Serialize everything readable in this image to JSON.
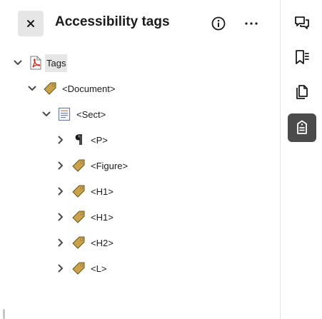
{
  "header": {
    "title": "Accessibility tags",
    "close_icon": "close-icon",
    "info_icon": "info-icon",
    "more_icon": "more-icon"
  },
  "tree": {
    "root": {
      "label": "Tags",
      "icon": "pdf-file-icon",
      "expanded": true,
      "selected": true
    },
    "document": {
      "label": "<Document>",
      "icon": "tag-icon",
      "expanded": true
    },
    "sect": {
      "label": "<Sect>",
      "icon": "section-icon",
      "expanded": true
    },
    "children": [
      {
        "label": "<P>",
        "icon": "paragraph-icon",
        "expanded": false
      },
      {
        "label": "<Figure>",
        "icon": "tag-icon",
        "expanded": false
      },
      {
        "label": "<H1>",
        "icon": "tag-icon",
        "expanded": false
      },
      {
        "label": "<H1>",
        "icon": "tag-icon",
        "expanded": false
      },
      {
        "label": "<H2>",
        "icon": "tag-icon",
        "expanded": false
      },
      {
        "label": "<L>",
        "icon": "tag-icon",
        "expanded": false
      }
    ]
  },
  "rail": {
    "items": [
      {
        "name": "comments",
        "icon": "comments-icon",
        "active": false
      },
      {
        "name": "bookmarks",
        "icon": "bookmark-icon",
        "active": false
      },
      {
        "name": "pages",
        "icon": "pages-icon",
        "active": false
      },
      {
        "name": "accessibility-tags",
        "icon": "accessibility-tags-icon",
        "active": true
      }
    ]
  },
  "colors": {
    "active_rail": "#4b4b4b",
    "selected_bg": "#e6e6e6",
    "tag_gold": "#c9a24a",
    "pdf_red": "#d7261e"
  }
}
